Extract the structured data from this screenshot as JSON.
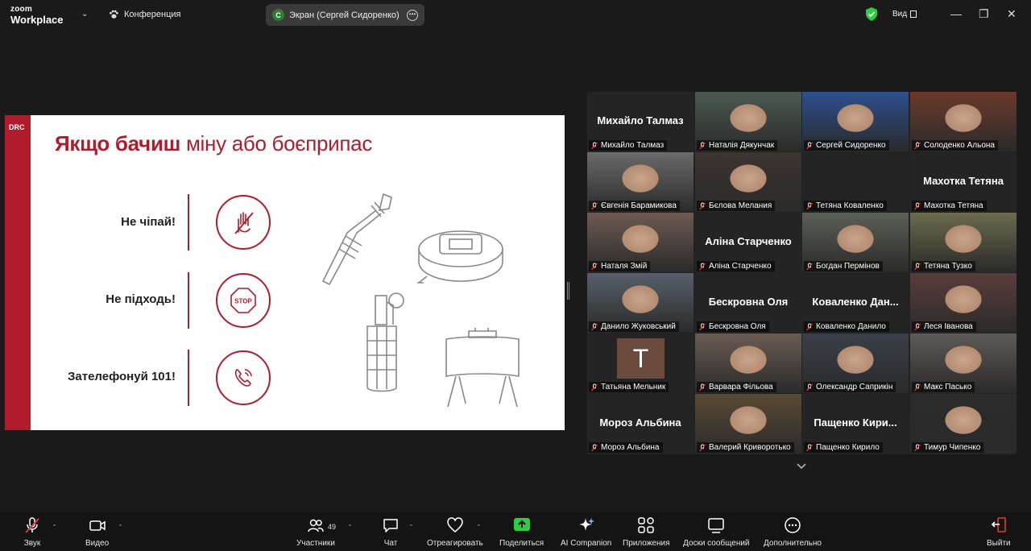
{
  "app": {
    "logo_line1": "zoom",
    "logo_line2": "Workplace",
    "meeting_title": "Конференция",
    "share_badge_letter": "С",
    "share_label": "Экран (Сергей Сидоренко)",
    "view_label": "Вид",
    "accent_green": "#2ecc40",
    "brand_red": "#b01c2c"
  },
  "slide": {
    "brand": "DRC",
    "title_bold": "Якщо бачиш",
    "title_rest": " міну або боєприпас",
    "rules": [
      {
        "text": "Не чіпай!",
        "icon": "no-touch-hand-icon"
      },
      {
        "text": "Не підходь!",
        "icon": "stop-sign-icon"
      },
      {
        "text": "Зателефонуй 101!",
        "icon": "phone-call-icon"
      }
    ],
    "stop_text": "STOP"
  },
  "gallery": {
    "tiles": [
      {
        "name": "Михайло Талмаз",
        "show_big": true
      },
      {
        "name": "Наталія Дякунчак",
        "show_big": false
      },
      {
        "name": "Сергей Сидоренко",
        "show_big": false
      },
      {
        "name": "Солоденко Альона",
        "show_big": false
      },
      {
        "name": "Євгенія Барамикова",
        "show_big": false
      },
      {
        "name": "Бєлова Мелания",
        "show_big": false
      },
      {
        "name": "Тетяна Коваленко",
        "show_big": false
      },
      {
        "name": "Махотка Тетяна",
        "show_big": true
      },
      {
        "name": "Наталя Змій",
        "show_big": false
      },
      {
        "name": "Аліна Старченко",
        "show_big": true
      },
      {
        "name": "Богдан Пермінов",
        "show_big": false
      },
      {
        "name": "Тетяна Тузко",
        "show_big": false
      },
      {
        "name": "Данило Жуковський",
        "show_big": false
      },
      {
        "name": "Бескровна Оля",
        "show_big": true
      },
      {
        "name": "Коваленко Данило",
        "big_text": "Коваленко Дан...",
        "show_big": true
      },
      {
        "name": "Леся Іванова",
        "show_big": false
      },
      {
        "name": "Татьяна Мельник",
        "avatar_letter": "T",
        "show_big": false
      },
      {
        "name": "Варвара Фільова",
        "show_big": false
      },
      {
        "name": "Олександр Саприкін",
        "show_big": false
      },
      {
        "name": "Макс Пасько",
        "show_big": false
      },
      {
        "name": "Мороз Альбина",
        "show_big": true
      },
      {
        "name": "Валерий Криворотько",
        "show_big": false
      },
      {
        "name": "Пащенко Кирило",
        "big_text": "Пащенко Кири...",
        "show_big": true
      },
      {
        "name": "Тимур Чипенко",
        "show_big": false
      }
    ]
  },
  "toolbar": {
    "audio": "Звук",
    "video": "Видео",
    "participants": "Участники",
    "participants_count": "49",
    "chat": "Чат",
    "react": "Отреагировать",
    "share": "Поделиться",
    "ai": "AI Companion",
    "apps": "Приложения",
    "whiteboards": "Доски сообщений",
    "more": "Дополнительно",
    "leave": "Выйти"
  }
}
